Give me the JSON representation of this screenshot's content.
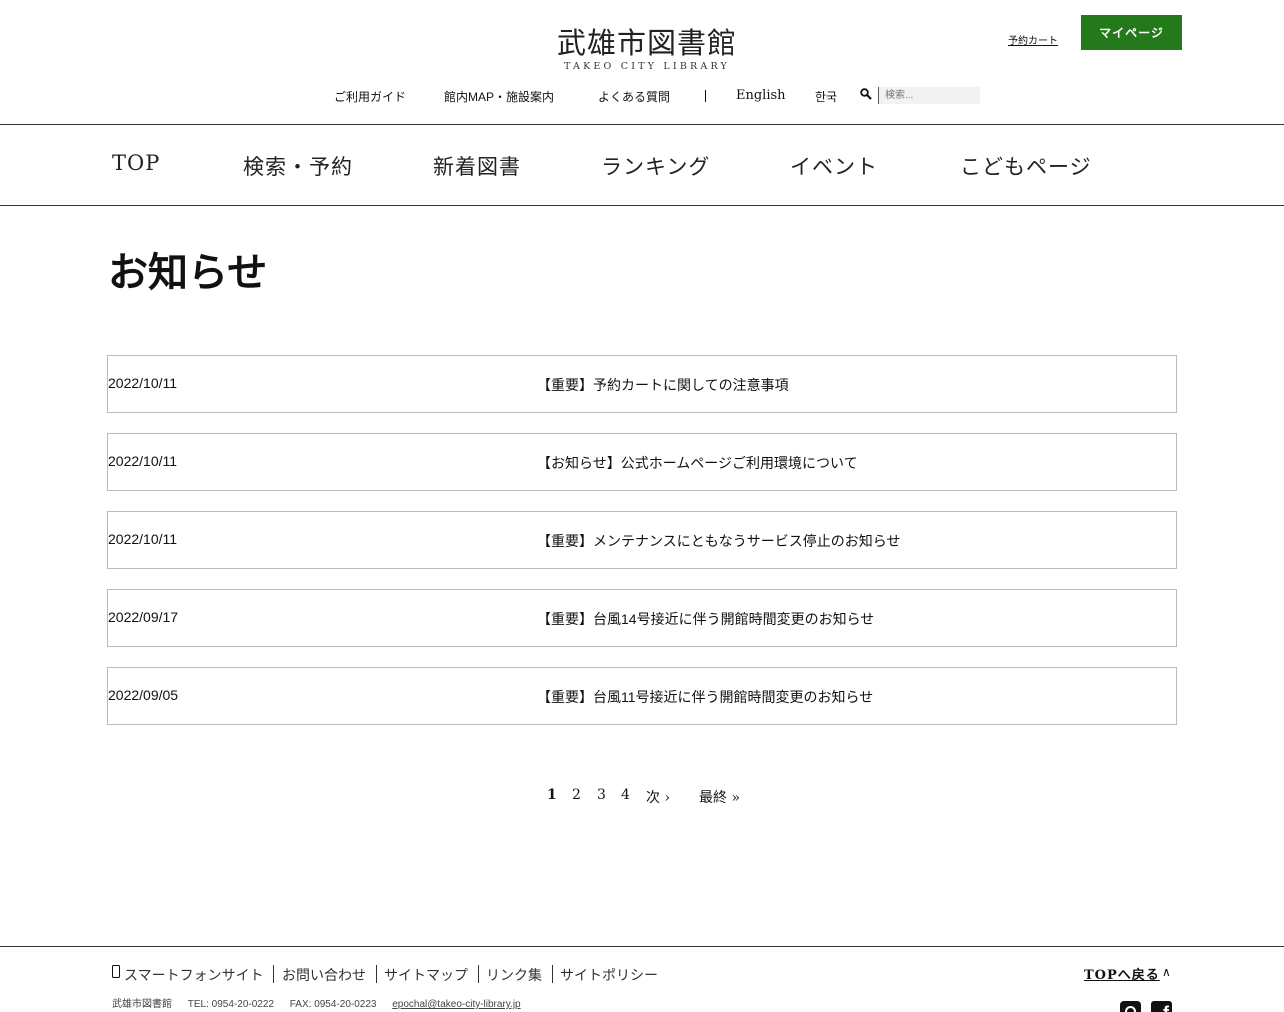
{
  "header": {
    "logo_ja": "武雄市図書館",
    "logo_en": "TAKEO CITY LIBRARY",
    "cart_link": "予約カート",
    "mypage_button": "マイページ"
  },
  "utility_nav": {
    "guide": "ご利用ガイド",
    "map": "館内MAP・施設案内",
    "faq": "よくある質問",
    "english": "English",
    "korean": "한국",
    "search_placeholder": "検索..."
  },
  "main_nav": [
    "TOP",
    "検索・予約",
    "新着図書",
    "ランキング",
    "イベント",
    "こどもページ"
  ],
  "page_title": "お知らせ",
  "news": [
    {
      "date": "2022/10/11",
      "title": "【重要】予約カートに関しての注意事項"
    },
    {
      "date": "2022/10/11",
      "title": "【お知らせ】公式ホームページご利用環境について"
    },
    {
      "date": "2022/10/11",
      "title": "【重要】メンテナンスにともなうサービス停止のお知らせ"
    },
    {
      "date": "2022/09/17",
      "title": "【重要】台風14号接近に伴う開館時間変更のお知らせ"
    },
    {
      "date": "2022/09/05",
      "title": "【重要】台風11号接近に伴う開館時間変更のお知らせ"
    }
  ],
  "pager": {
    "current": "1",
    "pages": [
      "2",
      "3",
      "4"
    ],
    "next": "次 ›",
    "last": "最終 »"
  },
  "footer": {
    "links": [
      "スマートフォンサイト",
      "お問い合わせ",
      "サイトマップ",
      "リンク集",
      "サイトポリシー"
    ],
    "library_name": "武雄市図書館",
    "tel": "TEL: 0954-20-0222",
    "fax": "FAX: 0954-20-0223",
    "email": "epochal@takeo-city-library.jp",
    "to_top": "TOPへ戻る"
  },
  "colors": {
    "accent": "#247a1a",
    "text": "#111111",
    "border": "#bbbbbb"
  }
}
